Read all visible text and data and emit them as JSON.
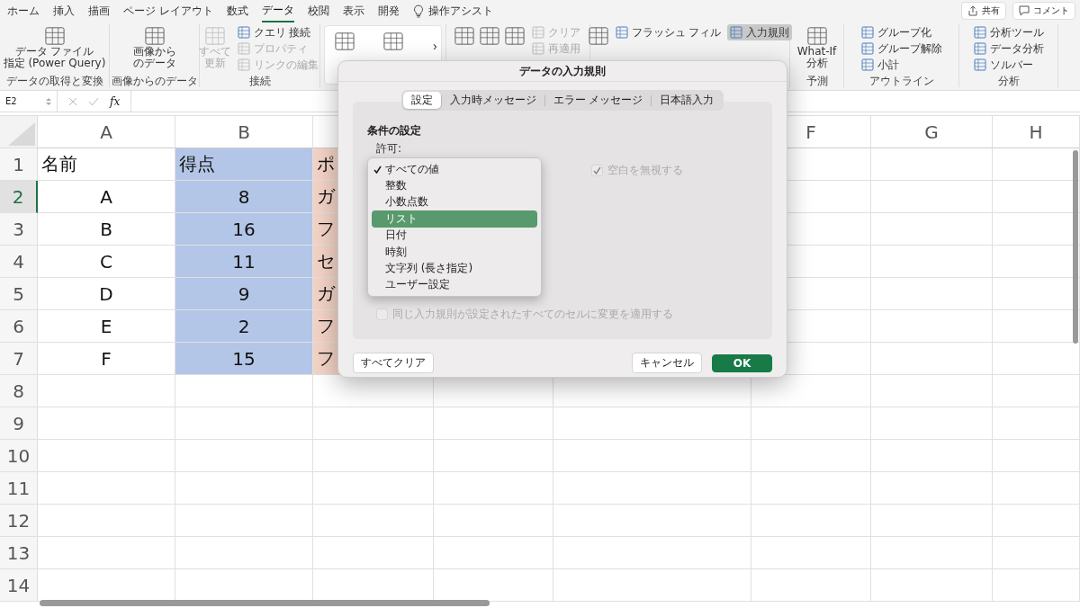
{
  "ribbon_tabs": [
    {
      "label": "ホーム",
      "selected": false
    },
    {
      "label": "挿入",
      "selected": false
    },
    {
      "label": "描画",
      "selected": false
    },
    {
      "label": "ページ レイアウト",
      "selected": false
    },
    {
      "label": "数式",
      "selected": false
    },
    {
      "label": "データ",
      "selected": true
    },
    {
      "label": "校閲",
      "selected": false
    },
    {
      "label": "表示",
      "selected": false
    },
    {
      "label": "開発",
      "selected": false
    }
  ],
  "tell_me": "操作アシスト",
  "share_button": "共有",
  "comment_button": "コメント",
  "ribbon_groups": [
    {
      "label": "データの取得と変換",
      "items": [
        {
          "kind": "large",
          "lines": [
            "データ ファイル",
            "指定 (Power Query)"
          ],
          "disabled": false
        }
      ]
    },
    {
      "label": "画像からのデータ",
      "items": [
        {
          "kind": "large",
          "lines": [
            "画像から",
            "のデータ"
          ],
          "disabled": false
        }
      ]
    },
    {
      "label": "接続",
      "items": [
        {
          "kind": "large",
          "lines": [
            "すべて",
            "更新"
          ],
          "disabled": true
        },
        {
          "kind": "stack",
          "items": [
            {
              "label": "クエリ 接続",
              "disabled": false,
              "selected": false
            },
            {
              "label": "プロパティ",
              "disabled": true,
              "selected": false
            },
            {
              "label": "リンクの編集",
              "disabled": true,
              "selected": false
            }
          ]
        }
      ]
    },
    {
      "kind": "gallery",
      "items": [
        {
          "kind": "large",
          "disabled": false
        },
        {
          "kind": "large",
          "disabled": false
        }
      ],
      "more": "›"
    },
    {
      "items": [
        {
          "kind": "large",
          "disabled": false
        },
        {
          "kind": "large",
          "disabled": false
        },
        {
          "kind": "large",
          "disabled": false
        },
        {
          "kind": "stack",
          "items": [
            {
              "label": "クリア",
              "disabled": true,
              "selected": false
            },
            {
              "label": "再適用",
              "disabled": true,
              "selected": false
            }
          ]
        }
      ]
    },
    {
      "items": [
        {
          "kind": "large",
          "disabled": false
        },
        {
          "kind": "stack",
          "items": [
            {
              "label": "フラッシュ フィル",
              "disabled": false,
              "selected": false
            }
          ]
        },
        {
          "kind": "stack",
          "items": [
            {
              "label": "入力規則",
              "disabled": false,
              "selected": true
            }
          ]
        }
      ]
    },
    {
      "label": "予測",
      "items": [
        {
          "kind": "large",
          "lines": [
            "What-If",
            "分析"
          ],
          "disabled": false
        }
      ]
    },
    {
      "label": "アウトライン",
      "items": [
        {
          "kind": "stack",
          "items": [
            {
              "label": "グループ化",
              "disabled": false,
              "selected": false
            },
            {
              "label": "グループ解除",
              "disabled": false,
              "selected": false
            },
            {
              "label": "小計",
              "disabled": false,
              "selected": false
            }
          ]
        }
      ]
    },
    {
      "label": "分析",
      "items": [
        {
          "kind": "stack",
          "items": [
            {
              "label": "分析ツール",
              "disabled": false,
              "selected": false
            },
            {
              "label": "データ分析",
              "disabled": false,
              "selected": false
            },
            {
              "label": "ソルバー",
              "disabled": false,
              "selected": false
            }
          ]
        }
      ]
    }
  ],
  "formula_bar": {
    "name_box": "E2",
    "fx": "fx"
  },
  "sheet": {
    "columns": [
      {
        "header": "A"
      },
      {
        "header": "B",
        "color": "#b4c6e7"
      },
      {
        "color": "#f3d3c6"
      },
      {},
      {},
      {
        "header": "F"
      },
      {
        "header": "G"
      },
      {
        "header": "H"
      }
    ],
    "rows": [
      {
        "header": "1",
        "selected": false,
        "cells": [
          "名前",
          "得点",
          "ポ"
        ]
      },
      {
        "header": "2",
        "selected": true,
        "cells": [
          "A",
          "8",
          "ガ"
        ]
      },
      {
        "header": "3",
        "selected": false,
        "cells": [
          "B",
          "16",
          "フ"
        ]
      },
      {
        "header": "4",
        "selected": false,
        "cells": [
          "C",
          "11",
          "セ"
        ]
      },
      {
        "header": "5",
        "selected": false,
        "cells": [
          "D",
          "9",
          "ガ"
        ]
      },
      {
        "header": "6",
        "selected": false,
        "cells": [
          "E",
          "2",
          "フ"
        ]
      },
      {
        "header": "7",
        "selected": false,
        "cells": [
          "F",
          "15",
          "フ"
        ]
      },
      {
        "header": "8",
        "selected": false
      },
      {
        "header": "9",
        "selected": false
      },
      {
        "header": "10",
        "selected": false
      },
      {
        "header": "11",
        "selected": false
      },
      {
        "header": "12",
        "selected": false
      },
      {
        "header": "13",
        "selected": false
      },
      {
        "header": "14",
        "selected": false
      }
    ]
  },
  "dialog": {
    "title": "データの入力規則",
    "tabs": [
      {
        "label": "設定",
        "selected": true
      },
      {
        "label": "入力時メッセージ",
        "selected": false
      },
      {
        "label": "エラー メッセージ",
        "selected": false
      },
      {
        "label": "日本語入力",
        "selected": false
      }
    ],
    "section": "条件の設定",
    "allow_label": "許可:",
    "allow_options": [
      {
        "label": "すべての値",
        "checked": true,
        "selected": false
      },
      {
        "label": "整数",
        "checked": false,
        "selected": false
      },
      {
        "label": "小数点数",
        "checked": false,
        "selected": false
      },
      {
        "label": "リスト",
        "checked": false,
        "selected": true
      },
      {
        "label": "日付",
        "checked": false,
        "selected": false
      },
      {
        "label": "時刻",
        "checked": false,
        "selected": false
      },
      {
        "label": "文字列 (長さ指定)",
        "checked": false,
        "selected": false
      },
      {
        "label": "ユーザー設定",
        "checked": false,
        "selected": false
      }
    ],
    "ignore_blank": {
      "label": "空白を無視する",
      "checked": true,
      "disabled": true
    },
    "apply_all": {
      "label": "同じ入力規則が設定されたすべてのセルに変更を適用する",
      "checked": false,
      "disabled": true
    },
    "clear_button": "すべてクリア",
    "cancel_button": "キャンセル",
    "ok_button": "OK"
  }
}
